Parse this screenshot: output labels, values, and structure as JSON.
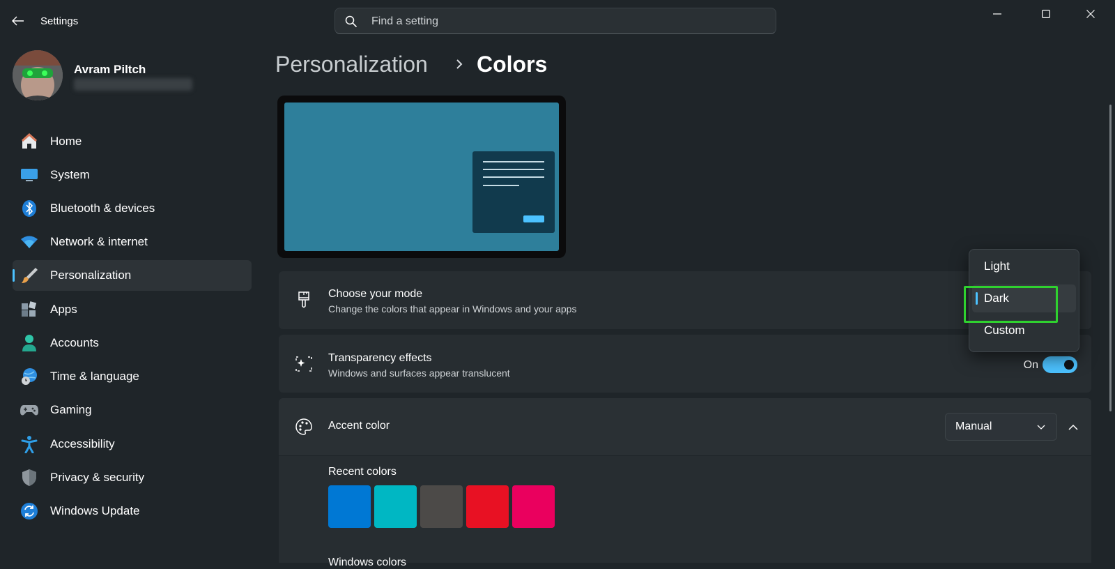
{
  "window": {
    "title": "Settings",
    "controls": [
      "minimize",
      "maximize",
      "close"
    ]
  },
  "search": {
    "placeholder": "Find a setting",
    "value": ""
  },
  "user": {
    "name": "Avram Piltch",
    "email": ""
  },
  "sidebar": {
    "items": [
      {
        "label": "Home",
        "icon": "home-icon",
        "active": false
      },
      {
        "label": "System",
        "icon": "system-icon",
        "active": false
      },
      {
        "label": "Bluetooth & devices",
        "icon": "bluetooth-icon",
        "active": false
      },
      {
        "label": "Network & internet",
        "icon": "wifi-icon",
        "active": false
      },
      {
        "label": "Personalization",
        "icon": "brush-icon",
        "active": true
      },
      {
        "label": "Apps",
        "icon": "apps-icon",
        "active": false
      },
      {
        "label": "Accounts",
        "icon": "person-icon",
        "active": false
      },
      {
        "label": "Time & language",
        "icon": "globe-clock-icon",
        "active": false
      },
      {
        "label": "Gaming",
        "icon": "gamepad-icon",
        "active": false
      },
      {
        "label": "Accessibility",
        "icon": "accessibility-icon",
        "active": false
      },
      {
        "label": "Privacy & security",
        "icon": "shield-icon",
        "active": false
      },
      {
        "label": "Windows Update",
        "icon": "update-icon",
        "active": false
      }
    ]
  },
  "breadcrumb": {
    "parent": "Personalization",
    "current": "Colors"
  },
  "cards": {
    "mode": {
      "title": "Choose your mode",
      "subtitle": "Change the colors that appear in Windows and your apps"
    },
    "transparency": {
      "title": "Transparency effects",
      "subtitle": "Windows and surfaces appear translucent",
      "state_label": "On",
      "enabled": true
    },
    "accent": {
      "title": "Accent color",
      "selected": "Manual"
    }
  },
  "mode_dropdown": {
    "options": [
      "Light",
      "Dark",
      "Custom"
    ],
    "selected": "Dark"
  },
  "recent_colors": {
    "label": "Recent colors",
    "colors": [
      "#0078d4",
      "#00b7c3",
      "#4c4a48",
      "#e81123",
      "#ea005e"
    ]
  },
  "windows_colors": {
    "label": "Windows colors"
  },
  "theme": {
    "accent": "#4cc2ff",
    "highlight": "#2fd12f",
    "background": "#1f2529",
    "card": "#272d31"
  }
}
